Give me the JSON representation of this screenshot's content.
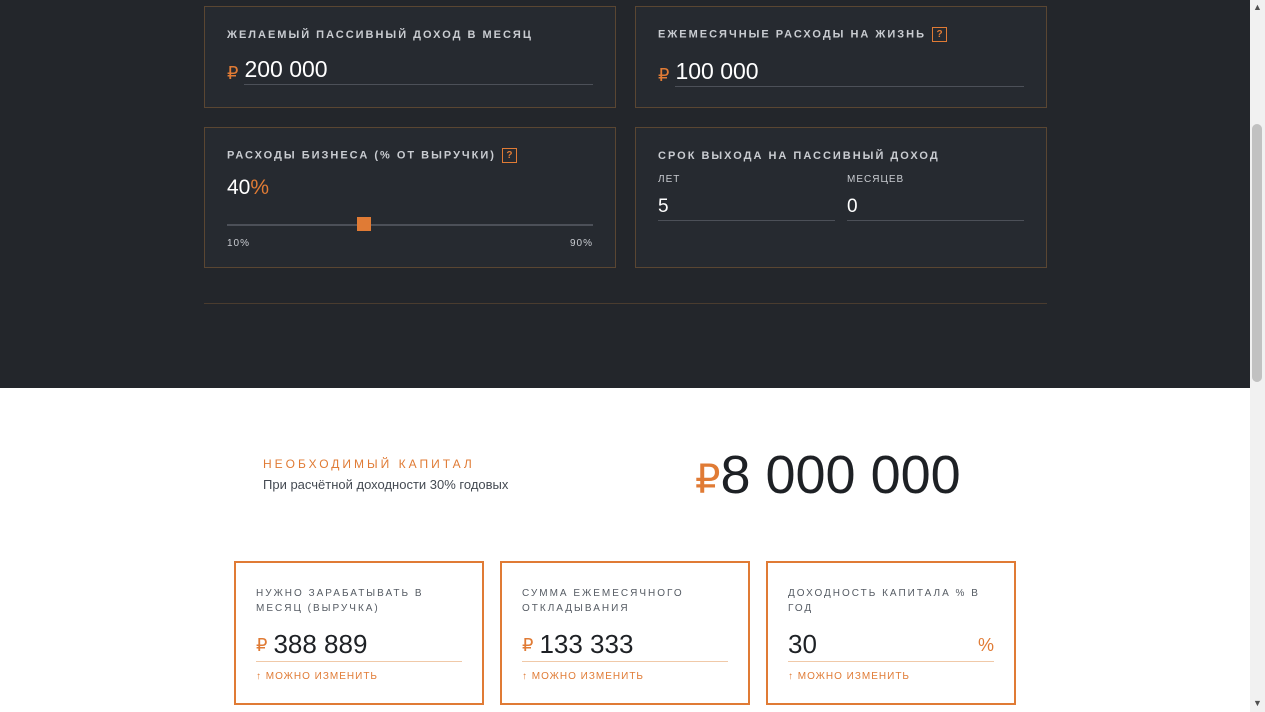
{
  "inputs": {
    "passive_income": {
      "label": "ЖЕЛАЕМЫЙ ПАССИВНЫЙ ДОХОД В МЕСЯЦ",
      "currency": "₽",
      "value": "200 000"
    },
    "living_expenses": {
      "label": "ЕЖЕМЕСЯЧНЫЕ РАСХОДЫ НА ЖИЗНЬ",
      "help": "?",
      "currency": "₽",
      "value": "100 000"
    },
    "business_expenses": {
      "label": "РАСХОДЫ БИЗНЕСА (% ОТ ВЫРУЧКИ)",
      "help": "?",
      "value": "40",
      "percent_sign": "%",
      "slider_fraction": 0.375,
      "min_label": "10%",
      "max_label": "90%"
    },
    "term": {
      "label": "СРОК ВЫХОДА НА ПАССИВНЫЙ ДОХОД",
      "years_label": "ЛЕТ",
      "years_value": "5",
      "months_label": "МЕСЯЦЕВ",
      "months_value": "0"
    }
  },
  "capital": {
    "label": "НЕОБХОДИМЫЙ КАПИТАЛ",
    "subtitle": "При расчётной доходности 30% годовых",
    "currency": "₽",
    "value": "8 000 000"
  },
  "results": [
    {
      "label": "НУЖНО ЗАРАБАТЫВАТЬ В МЕСЯЦ (ВЫРУЧКА)",
      "currency": "₽",
      "value": "388 889",
      "hint": "↑ МОЖНО ИЗМЕНИТЬ"
    },
    {
      "label": "СУММА ЕЖЕМЕСЯЧНОГО ОТКЛАДЫВАНИЯ",
      "currency": "₽",
      "value": "133 333",
      "hint": "↑ МОЖНО ИЗМЕНИТЬ"
    },
    {
      "label": "ДОХОДНОСТЬ КАПИТАЛА % В ГОД",
      "value": "30",
      "unit": "%",
      "hint": "↑ МОЖНО ИЗМЕНИТЬ"
    }
  ],
  "colors": {
    "accent": "#e07b35",
    "dark_bg": "#23262b",
    "card_border": "#5a4632"
  }
}
